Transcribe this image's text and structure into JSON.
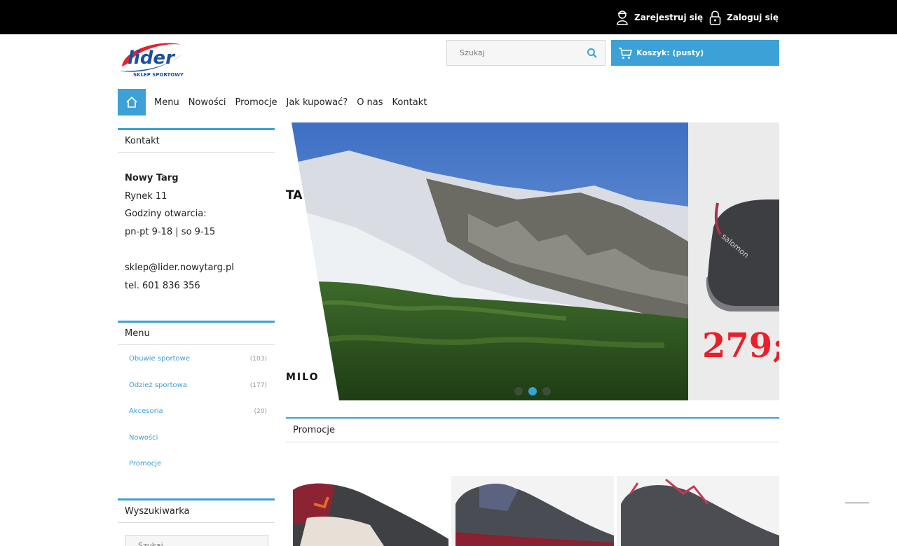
{
  "topbar": {
    "register_label": "Zarejestruj się",
    "login_label": "Zaloguj się"
  },
  "header": {
    "logo_text": "lider",
    "logo_subtext": "SKLEP SPORTOWY",
    "search_placeholder": "Szukaj",
    "cart_label": "Koszyk: (pusty)"
  },
  "nav": {
    "items": [
      "Menu",
      "Nowości",
      "Promocje",
      "Jak kupować?",
      "O nas",
      "Kontakt"
    ]
  },
  "sidebar": {
    "contact": {
      "title": "Kontakt",
      "city": "Nowy Targ",
      "address": "Rynek 11",
      "hours_label": "Godziny otwarcia:",
      "hours": "pn-pt 9-18 | so 9-15",
      "email": "sklep@lider.nowytarg.pl",
      "phone": "tel. 601 836 356"
    },
    "menu": {
      "title": "Menu",
      "items": [
        {
          "label": "Obuwie sportowe",
          "count": "(103)"
        },
        {
          "label": "Odzież sportowa",
          "count": "(177)"
        },
        {
          "label": "Akcesoria",
          "count": "(20)"
        },
        {
          "label": "Nowości",
          "count": ""
        },
        {
          "label": "Promocje",
          "count": ""
        }
      ]
    },
    "finder": {
      "title": "Wyszukiwarka",
      "placeholder": "Szukaj"
    }
  },
  "slider": {
    "price_text": "279;",
    "shoe_brand": "salomon",
    "partial_text_left": "TA",
    "partial_logo": "MILO",
    "slides_count": 3,
    "active_slide": 2
  },
  "promotions": {
    "title": "Promocje"
  },
  "colors": {
    "accent": "#3ba1d6",
    "topbar": "#000000",
    "price_red": "#e8202a"
  }
}
